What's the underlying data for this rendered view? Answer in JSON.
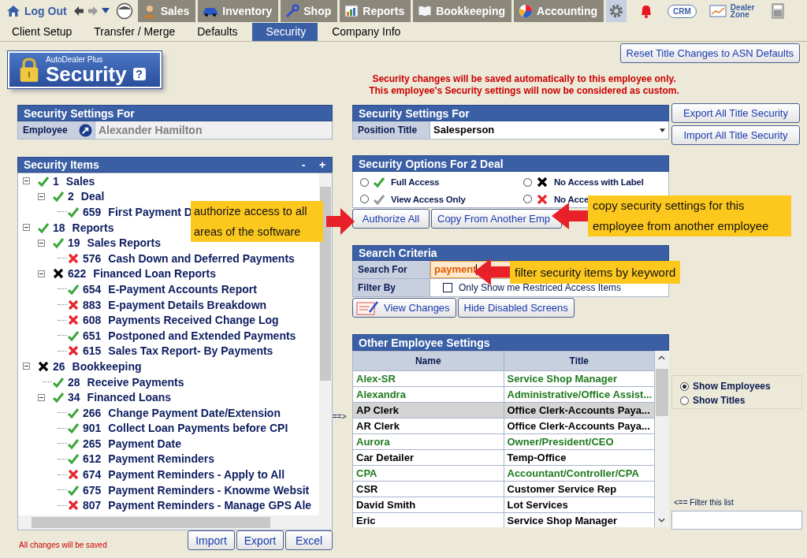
{
  "topbar": {
    "logout": "Log Out",
    "tabs": [
      {
        "label": "Sales",
        "kind": "person"
      },
      {
        "label": "Inventory",
        "kind": "car"
      },
      {
        "label": "Shop",
        "kind": "wrench"
      },
      {
        "label": "Reports",
        "kind": "report"
      },
      {
        "label": "Bookkeeping",
        "kind": "book"
      },
      {
        "label": "Accounting",
        "kind": "pie"
      }
    ],
    "crm": "CRM",
    "dealer_zone": "Dealer Zone"
  },
  "subtabs": [
    {
      "label": "Client Setup",
      "selected": false
    },
    {
      "label": "Transfer / Merge",
      "selected": false
    },
    {
      "label": "Defaults",
      "selected": false
    },
    {
      "label": "Security",
      "selected": true
    },
    {
      "label": "Company Info",
      "selected": false
    }
  ],
  "logo": {
    "brand": "AutoDealer Plus",
    "title": "Security",
    "help": "?"
  },
  "reset_button": "Reset Title Changes to ASN Defaults",
  "messages": [
    "Security changes will be saved automatically to this employee only.",
    "This employee's Security settings will now be considered as custom."
  ],
  "employee_panel": {
    "title": "Security Settings For",
    "label": "Employee",
    "value": "Alexander Hamilton"
  },
  "items_panel": {
    "title": "Security Items",
    "collapse": "-",
    "expand": "+",
    "tree": [
      {
        "number": "1",
        "label": "Sales",
        "kind": "full",
        "expanded": true,
        "children": [
          {
            "number": "2",
            "label": "Deal",
            "kind": "full",
            "expanded": true,
            "children": [
              {
                "number": "659",
                "label": "First Payment D",
                "kind": "full"
              }
            ]
          }
        ]
      },
      {
        "number": "18",
        "label": "Reports",
        "kind": "full",
        "expanded": true,
        "children": [
          {
            "number": "19",
            "label": "Sales Reports",
            "kind": "full",
            "expanded": true,
            "children": [
              {
                "number": "576",
                "label": "Cash Down and Deferred Payments",
                "kind": "none"
              }
            ]
          },
          {
            "number": "622",
            "label": "Financed Loan Reports",
            "kind": "none_label",
            "expanded": true,
            "children": [
              {
                "number": "654",
                "label": "E-Payment Accounts Report",
                "kind": "full"
              },
              {
                "number": "883",
                "label": "E-payment Details Breakdown",
                "kind": "none"
              },
              {
                "number": "608",
                "label": "Payments Received Change Log",
                "kind": "none"
              },
              {
                "number": "651",
                "label": "Postponed and Extended Payments",
                "kind": "full"
              },
              {
                "number": "615",
                "label": "Sales Tax Report- By Payments",
                "kind": "none"
              }
            ]
          }
        ]
      },
      {
        "number": "26",
        "label": "Bookkeeping",
        "kind": "none_label",
        "expanded": true,
        "children": [
          {
            "number": "28",
            "label": "Receive Payments",
            "kind": "full"
          },
          {
            "number": "34",
            "label": "Financed Loans",
            "kind": "full",
            "expanded": true,
            "children": [
              {
                "number": "266",
                "label": "Change Payment Date/Extension",
                "kind": "full"
              },
              {
                "number": "901",
                "label": "Collect Loan Payments before CPI",
                "kind": "full"
              },
              {
                "number": "265",
                "label": "Payment Date",
                "kind": "full"
              },
              {
                "number": "612",
                "label": "Payment Reminders",
                "kind": "full"
              },
              {
                "number": "674",
                "label": "Payment Reminders - Apply to All",
                "kind": "none"
              },
              {
                "number": "675",
                "label": "Payment Reminders - Knowme Websit",
                "kind": "full"
              },
              {
                "number": "807",
                "label": "Payment Reminders - Manage GPS Ale",
                "kind": "none"
              }
            ]
          }
        ]
      }
    ],
    "footer_note": "All changes will be saved",
    "buttons": [
      "Import",
      "Export",
      "Excel"
    ]
  },
  "pointer": "==>",
  "position_panel": {
    "title": "Security Settings For",
    "label": "Position Title",
    "value": "Salesperson"
  },
  "title_buttons": [
    "Export All Title Security",
    "Import All Title Security"
  ],
  "options_panel": {
    "title": "Security Options For 2  Deal",
    "options": [
      {
        "label": "Full Access",
        "kind": "full",
        "selected": false
      },
      {
        "label": "No Access with Label",
        "kind": "none_label",
        "selected": false
      },
      {
        "label": "View Access Only",
        "kind": "view",
        "selected": false
      },
      {
        "label": "No Acce",
        "kind": "none",
        "selected": false
      }
    ],
    "buttons": [
      "Authorize All",
      "Copy From Another Emp"
    ]
  },
  "search_panel": {
    "title": "Search Criteria",
    "search_label": "Search For",
    "search_value": "payment",
    "filter_label": "Filter By",
    "filter_option": {
      "label": "Only Show me Restriced Access Items",
      "checked": false
    },
    "buttons": [
      "View Changes",
      "Hide Disabled Screens"
    ]
  },
  "employees": {
    "title": "Other Employee Settings",
    "columns": [
      "Name",
      "Title"
    ],
    "rows": [
      {
        "name": "Alex-SR",
        "title": "Service Shop Manager",
        "color": "#1f7a1f",
        "selected": false
      },
      {
        "name": "Alexandra",
        "title": "Administrative/Office Assist...",
        "color": "#1f7a1f",
        "selected": false
      },
      {
        "name": "AP Clerk",
        "title": "Office Clerk-Accounts Paya...",
        "color": "#000000",
        "selected": true
      },
      {
        "name": "AR Clerk",
        "title": "Office Clerk-Accounts Paya...",
        "color": "#000000",
        "selected": false
      },
      {
        "name": "Aurora",
        "title": "Owner/President/CEO",
        "color": "#1f7a1f",
        "selected": false
      },
      {
        "name": "Car Detailer",
        "title": "Temp-Office",
        "color": "#000000",
        "selected": false
      },
      {
        "name": "CPA",
        "title": "Accountant/Controller/CPA",
        "color": "#1f7a1f",
        "selected": false
      },
      {
        "name": "CSR",
        "title": "Customer Service Rep",
        "color": "#000000",
        "selected": false
      },
      {
        "name": "David Smith",
        "title": "Lot Services",
        "color": "#000000",
        "selected": false
      },
      {
        "name": "Eric",
        "title": "Service Shop Manager",
        "color": "#000000",
        "selected": false
      }
    ]
  },
  "show_options": [
    {
      "label": "Show Employees",
      "selected": true
    },
    {
      "label": "Show Titles",
      "selected": false
    }
  ],
  "filter_list_label": "<== Filter this list",
  "callouts": [
    {
      "text": "authorize access to all areas of the software",
      "kind": "right"
    },
    {
      "text": "copy security settings for this employee from another employee",
      "kind": "left"
    },
    {
      "text": "filter security items by keyword",
      "kind": "left"
    }
  ]
}
